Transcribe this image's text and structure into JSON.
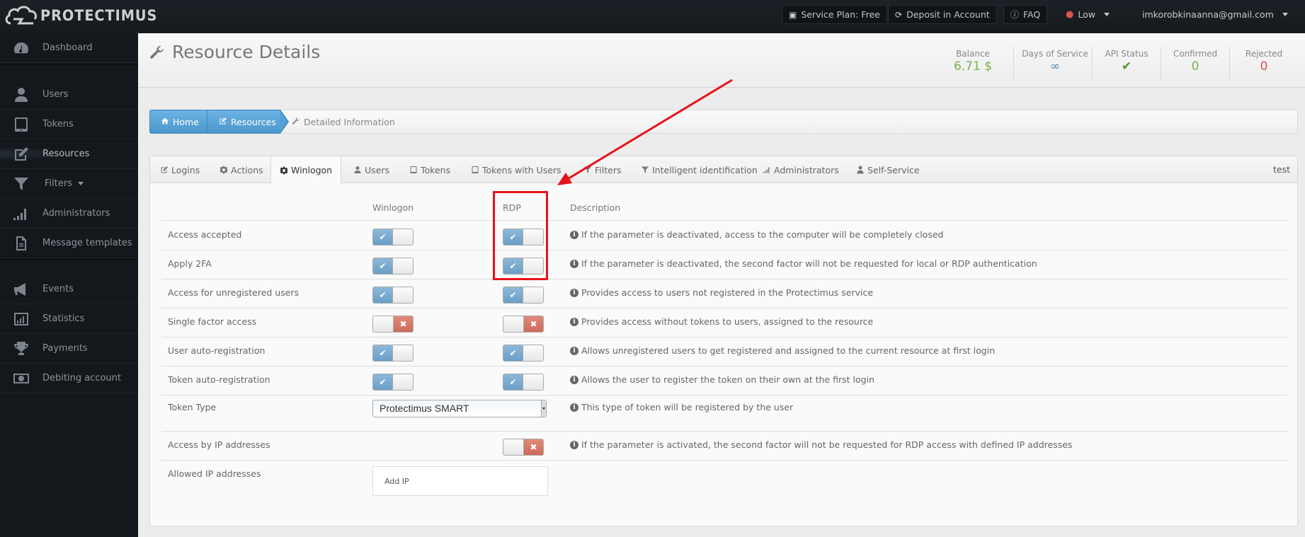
{
  "app": {
    "brand": "PROTECTIMUS"
  },
  "topbar": {
    "service_plan": "Service Plan: Free",
    "deposit": "Deposit in Account",
    "faq": "FAQ",
    "level": "Low",
    "user_email": "imkorobkinaanna@gmail.com"
  },
  "sidebar": {
    "items": [
      {
        "label": "Dashboard",
        "icon": "dashboard-icon"
      },
      {
        "label": "Users",
        "icon": "user-icon"
      },
      {
        "label": "Tokens",
        "icon": "tablet-icon"
      },
      {
        "label": "Resources",
        "icon": "edit-icon",
        "active": true
      },
      {
        "label": "Filters",
        "icon": "filter-icon"
      },
      {
        "label": "Administrators",
        "icon": "signal-icon"
      },
      {
        "label": "Message templates",
        "icon": "file-icon"
      },
      {
        "label": "Events",
        "icon": "bullhorn-icon"
      },
      {
        "label": "Statistics",
        "icon": "bar-chart-icon"
      },
      {
        "label": "Payments",
        "icon": "trophy-icon"
      },
      {
        "label": "Debiting account",
        "icon": "money-icon"
      }
    ]
  },
  "header": {
    "title": "Resource Details",
    "stats": [
      {
        "label": "Balance",
        "value": "6.71 $",
        "color": "#7ab24a"
      },
      {
        "label": "Days of Service",
        "value": "∞",
        "color": "#4f87b5"
      },
      {
        "label": "API Status",
        "value": "✔",
        "color": "#4e9a2a"
      },
      {
        "label": "Confirmed",
        "value": "0",
        "color": "#7ab24a"
      },
      {
        "label": "Rejected",
        "value": "0",
        "color": "#d9534f"
      }
    ]
  },
  "breadcrumb": {
    "home": "Home",
    "resources": "Resources",
    "current": "Detailed Information"
  },
  "tabs": {
    "items": [
      {
        "label": "Logins"
      },
      {
        "label": "Actions"
      },
      {
        "label": "Winlogon",
        "active": true
      },
      {
        "label": "Users"
      },
      {
        "label": "Tokens"
      },
      {
        "label": "Tokens with Users"
      },
      {
        "label": "Filters"
      },
      {
        "label": "Intelligent identification"
      },
      {
        "label": "Administrators"
      },
      {
        "label": "Self-Service"
      }
    ],
    "resource_name": "test"
  },
  "table": {
    "headers": {
      "winlogon": "Winlogon",
      "rdp": "RDP",
      "description": "Description"
    },
    "rows": [
      {
        "label": "Access accepted",
        "winlogon": true,
        "rdp": true,
        "description": "If the parameter is deactivated, access to the computer will be completely closed"
      },
      {
        "label": "Apply 2FA",
        "winlogon": true,
        "rdp": true,
        "description": "If the parameter is deactivated, the second factor will not be requested for local or RDP authentication"
      },
      {
        "label": "Access for unregistered users",
        "winlogon": true,
        "rdp": true,
        "description": "Provides access to users not registered in the Protectimus service"
      },
      {
        "label": "Single factor access",
        "winlogon": false,
        "rdp": false,
        "description": "Provides access without tokens to users, assigned to the resource"
      },
      {
        "label": "User auto-registration",
        "winlogon": true,
        "rdp": true,
        "description": "Allows unregistered users to get registered and assigned to the current resource at first login"
      },
      {
        "label": "Token auto-registration",
        "winlogon": true,
        "rdp": true,
        "description": "Allows the user to register the token on their own at the first login"
      }
    ],
    "token_type": {
      "label": "Token Type",
      "selected": "Protectimus SMART",
      "description": "This type of token will be registered by the user"
    },
    "ip_access": {
      "label": "Access by IP addresses",
      "rdp": false,
      "description": "If the parameter is activated, the second factor will not be requested for RDP access with defined IP addresses"
    },
    "allowed_ips": {
      "label": "Allowed IP addresses",
      "placeholder": "Add IP"
    }
  },
  "toggle_glyphs": {
    "on": "✔",
    "off": "✖"
  },
  "info_glyph": "i",
  "colors": {
    "annotation": "#e8121a",
    "breadcrumb": "#4a97cc",
    "toggle_on": "#6a9fc6",
    "toggle_off": "#cc6a5a"
  }
}
